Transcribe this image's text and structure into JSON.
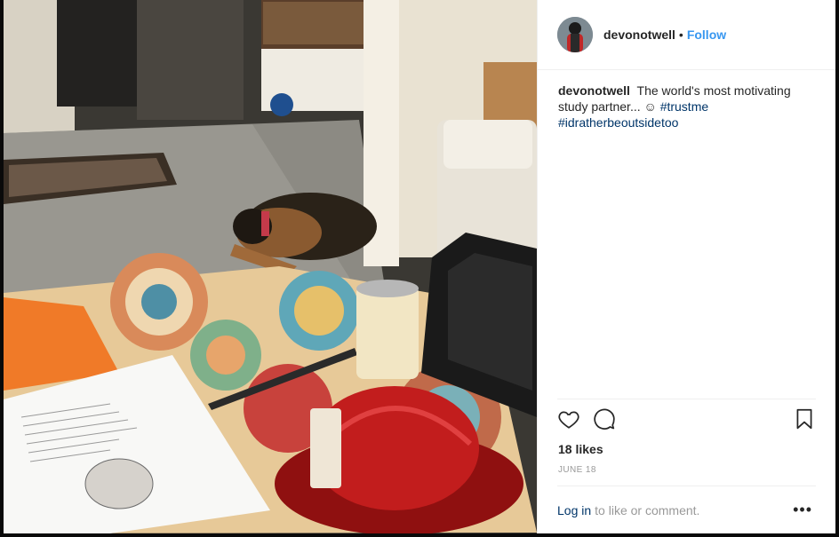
{
  "post": {
    "author": "devonotwell",
    "separator": "•",
    "follow_label": "Follow",
    "caption_text": "The world's most motivating study partner... ☺",
    "hashtags": [
      "#trustme",
      "#idratherbeoutsidetoo"
    ],
    "likes": "18 likes",
    "date": "JUNE 18",
    "login_label": "Log in",
    "login_suffix": "to like or comment.",
    "more_label": "•••"
  },
  "icons": {
    "like": "heart-icon",
    "comment": "comment-bubble-icon",
    "save": "bookmark-icon",
    "more": "more-options-icon"
  },
  "colors": {
    "follow_blue": "#3897f0",
    "hashtag_blue": "#003569",
    "text": "#262626",
    "muted": "#999999"
  }
}
